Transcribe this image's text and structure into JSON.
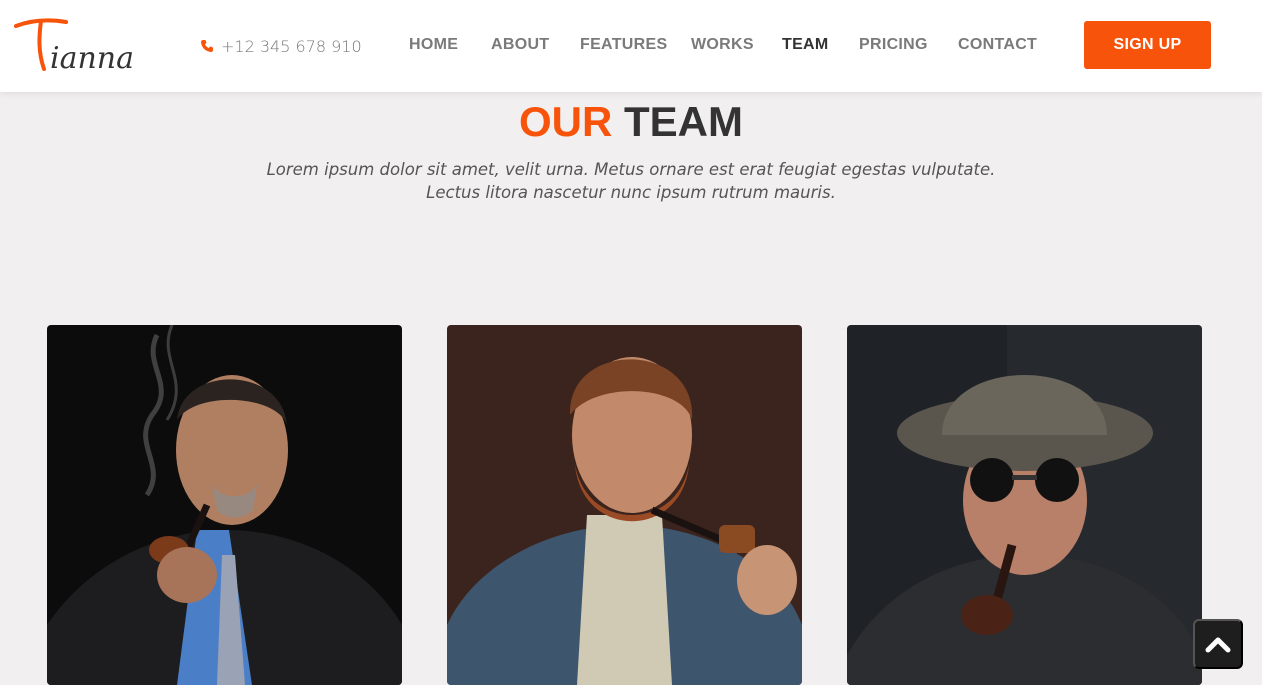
{
  "brand": {
    "logo_text": "Tianna",
    "accent_color": "#f7530b"
  },
  "header": {
    "phone": "+12 345 678 910",
    "phone_icon": "phone-icon",
    "nav": [
      {
        "label": "HOME",
        "active": false
      },
      {
        "label": "ABOUT",
        "active": false
      },
      {
        "label": "FEATURES",
        "active": false
      },
      {
        "label": "WORKS",
        "active": false
      },
      {
        "label": "TEAM",
        "active": true
      },
      {
        "label": "PRICING",
        "active": false
      },
      {
        "label": "CONTACT",
        "active": false
      }
    ],
    "signup_label": "SIGN UP"
  },
  "team": {
    "title_accent": "OUR",
    "title_rest": "TEAM",
    "description": "Lorem ipsum dolor sit amet, velit urna. Metus ornare est erat feugiat egestas vulputate. Lectus litora nascetur nunc ipsum rutrum mauris.",
    "members": [
      {
        "photo": "man-with-pipe-in-suit-photo"
      },
      {
        "photo": "bearded-man-with-pipe-photo"
      },
      {
        "photo": "man-with-pith-helmet-and-pipe-photo"
      }
    ]
  },
  "back_to_top_icon": "chevron-up-icon"
}
